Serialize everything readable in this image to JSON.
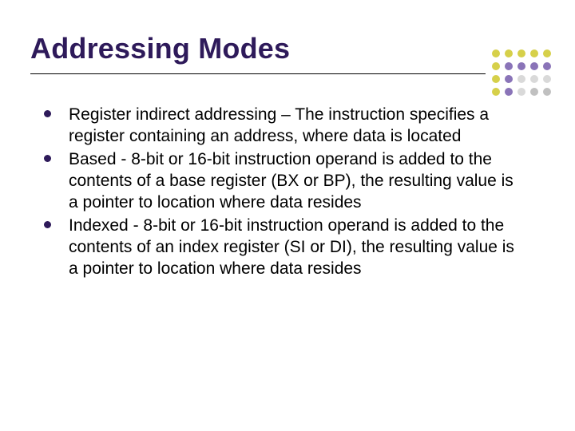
{
  "title": "Addressing Modes",
  "bullets": [
    "Register indirect addressing – The instruction specifies a register containing an address, where data is located",
    "Based - 8-bit or 16-bit instruction operand is added to the contents of a base register (BX or BP), the resulting value is a pointer to location where data resides",
    "Indexed - 8-bit or 16-bit instruction operand is added to the contents of an index register (SI or DI), the resulting value is a pointer to location where data resides"
  ],
  "decor": {
    "rows": [
      [
        "#d6d04a",
        "#d6d04a",
        "#d6d04a",
        "#d6d04a",
        "#d6d04a"
      ],
      [
        "#d6d04a",
        "#8a74b8",
        "#8a74b8",
        "#8a74b8",
        "#8a74b8"
      ],
      [
        "#d6d04a",
        "#8a74b8",
        "#d9d9d9",
        "#d9d9d9",
        "#d9d9d9"
      ],
      [
        "#d6d04a",
        "#8a74b8",
        "#d9d9d9",
        "#c0c0c0",
        "#c0c0c0"
      ]
    ]
  }
}
